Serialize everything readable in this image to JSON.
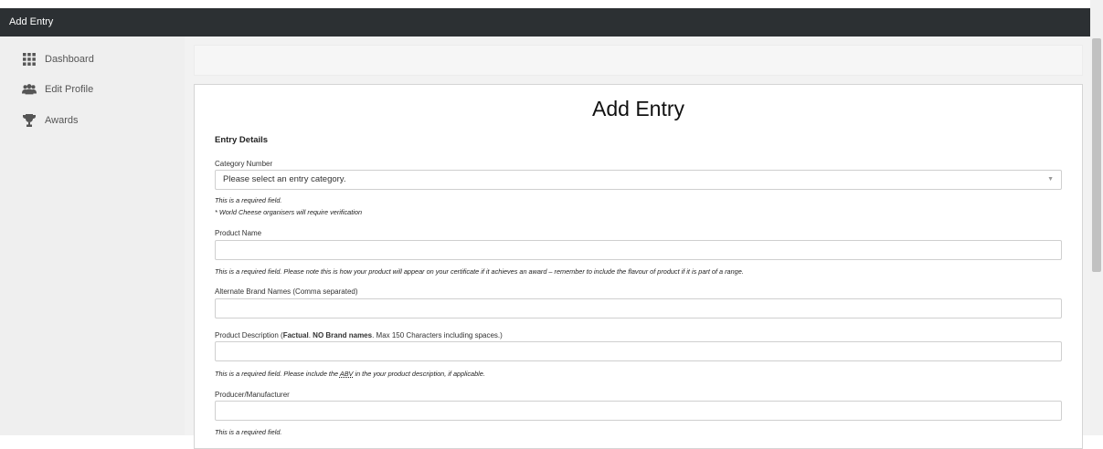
{
  "header": {
    "title": "Add Entry"
  },
  "sidebar": {
    "items": [
      {
        "label": "Dashboard",
        "icon": "grid-icon"
      },
      {
        "label": "Edit Profile",
        "icon": "users-icon"
      },
      {
        "label": "Awards",
        "icon": "trophy-icon"
      }
    ]
  },
  "form": {
    "title": "Add Entry",
    "section_title": "Entry Details",
    "category": {
      "label": "Category Number",
      "selected": "Please select an entry category.",
      "help1": "This is a required field.",
      "help2": "* World Cheese organisers will require verification"
    },
    "product_name": {
      "label": "Product Name",
      "value": "",
      "help": "This is a required field. Please note this is how your product will appear on your certificate if it achieves an award – remember to include the flavour of product if it is part of a range."
    },
    "alternate_brands": {
      "label": "Alternate Brand Names (Comma separated)",
      "value": ""
    },
    "description": {
      "label_prefix": "Product Description (",
      "label_bold1": "Factual",
      "label_mid1": ". ",
      "label_bold2": "NO Brand names",
      "label_suffix": ". Max 150 Characters including spaces.)",
      "value": "",
      "help_prefix": "This is a required field. Please include the ",
      "help_abbr": "ABV",
      "help_suffix": " in the your product description, if applicable."
    },
    "producer": {
      "label": "Producer/Manufacturer",
      "value": "",
      "help": "This is a required field."
    }
  },
  "colors": {
    "topbar": "#2c3033",
    "sidebar": "#efefef",
    "main_bg": "#f2f2f2"
  }
}
